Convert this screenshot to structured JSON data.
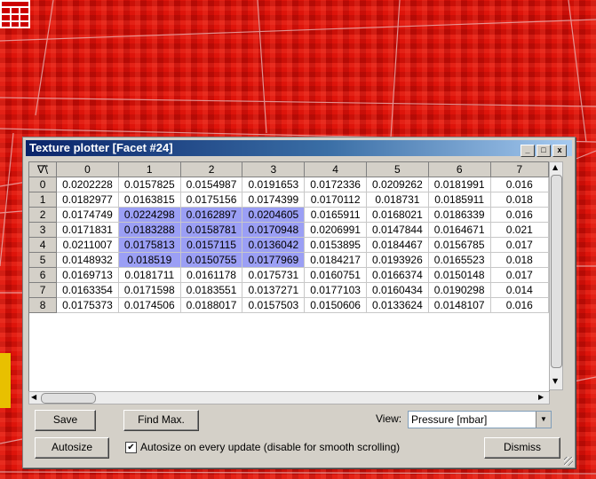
{
  "window": {
    "title": "Texture plotter [Facet #24]",
    "controls": {
      "minimize": "_",
      "maximize": "□",
      "close": "x"
    }
  },
  "table": {
    "corner": "∇\\⃗",
    "columns": [
      "0",
      "1",
      "2",
      "3",
      "4",
      "5",
      "6",
      "7"
    ],
    "rows": [
      {
        "index": "0",
        "cells": [
          "0.0202228",
          "0.0157825",
          "0.0154987",
          "0.0191653",
          "0.0172336",
          "0.0209262",
          "0.0181991",
          "0.016"
        ]
      },
      {
        "index": "1",
        "cells": [
          "0.0182977",
          "0.0163815",
          "0.0175156",
          "0.0174399",
          "0.0170112",
          "0.018731",
          "0.0185911",
          "0.018"
        ]
      },
      {
        "index": "2",
        "cells": [
          "0.0174749",
          "0.0224298",
          "0.0162897",
          "0.0204605",
          "0.0165911",
          "0.0168021",
          "0.0186339",
          "0.016"
        ]
      },
      {
        "index": "3",
        "cells": [
          "0.0171831",
          "0.0183288",
          "0.0158781",
          "0.0170948",
          "0.0206991",
          "0.0147844",
          "0.0164671",
          "0.021"
        ]
      },
      {
        "index": "4",
        "cells": [
          "0.0211007",
          "0.0175813",
          "0.0157115",
          "0.0136042",
          "0.0153895",
          "0.0184467",
          "0.0156785",
          "0.017"
        ]
      },
      {
        "index": "5",
        "cells": [
          "0.0148932",
          "0.018519",
          "0.0150755",
          "0.0177969",
          "0.0184217",
          "0.0193926",
          "0.0165523",
          "0.018"
        ]
      },
      {
        "index": "6",
        "cells": [
          "0.0169713",
          "0.0181711",
          "0.0161178",
          "0.0175731",
          "0.0160751",
          "0.0166374",
          "0.0150148",
          "0.017"
        ]
      },
      {
        "index": "7",
        "cells": [
          "0.0163354",
          "0.0171598",
          "0.0183551",
          "0.0137271",
          "0.0177103",
          "0.0160434",
          "0.0190298",
          "0.014"
        ]
      },
      {
        "index": "8",
        "cells": [
          "0.0175373",
          "0.0174506",
          "0.0188017",
          "0.0157503",
          "0.0150606",
          "0.0133624",
          "0.0148107",
          "0.016"
        ]
      }
    ],
    "selection": {
      "rows": [
        2,
        5
      ],
      "cols": [
        1,
        3
      ]
    },
    "selection_color": "#9b9ff5"
  },
  "buttons": {
    "save": "Save",
    "find_max": "Find Max.",
    "autosize": "Autosize",
    "dismiss": "Dismiss"
  },
  "view": {
    "label": "View:",
    "selected": "Pressure [mbar]"
  },
  "autosize_update": {
    "checked": true,
    "label": "Autosize on every update (disable for smooth scrolling)"
  },
  "colors": {
    "background_red": "#d81008",
    "titlebar_start": "#0a246a",
    "titlebar_end": "#a6caf0",
    "window_face": "#d4d0c8"
  },
  "icons": [
    "grid-icon",
    "minimize-icon",
    "maximize-icon",
    "close-icon",
    "checkmark-icon",
    "chevron-down-icon",
    "arrow-left-icon",
    "arrow-right-icon",
    "arrow-up-icon",
    "arrow-down-icon",
    "resize-grip-icon"
  ]
}
